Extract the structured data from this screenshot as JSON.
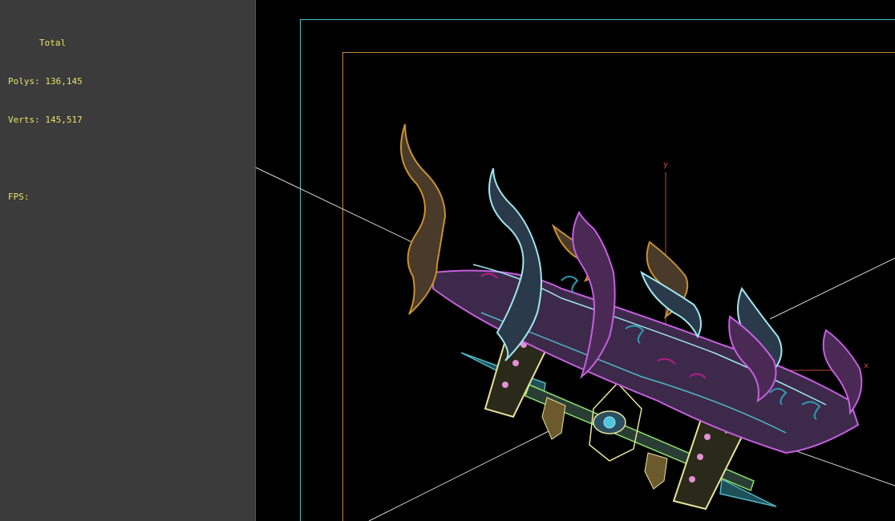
{
  "stats": {
    "header": "Total",
    "polys_label": "Polys:",
    "polys_value": "136,145",
    "verts_label": "Verts:",
    "verts_value": "145,517",
    "fps_label": "FPS:",
    "fps_value": ""
  },
  "axes": {
    "y_label": "y",
    "x_label": "x"
  },
  "colors": {
    "background": "#000000",
    "side_gray": "#3b3b3b",
    "stats_text": "#e8e26a",
    "safe_frame_outer": "#4fc6cf",
    "safe_frame_inner": "#c88a38",
    "axis": "#c9473a",
    "wire_gold": "#c7922c",
    "wire_cyan": "#9fe7ee",
    "wire_magenta": "#c75ee0",
    "wire_yellow": "#e8e39a",
    "wire_teal": "#4fb6c7",
    "wire_green": "#8de06a"
  }
}
